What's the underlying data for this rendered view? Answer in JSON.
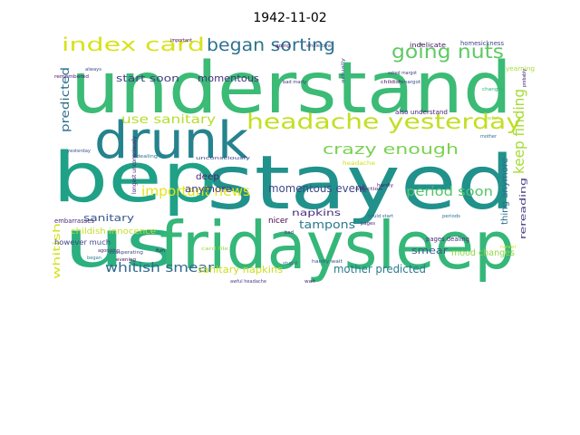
{
  "title": "1942-11-02",
  "words": [
    {
      "text": "understand",
      "color": "#3bbb75"
    },
    {
      "text": "stayed",
      "color": "#21918c"
    },
    {
      "text": "bep",
      "color": "#1fa187"
    },
    {
      "text": "us",
      "color": "#2bb07f"
    },
    {
      "text": "fridaysleep",
      "color": "#35b779"
    },
    {
      "text": "drunk",
      "color": "#25838e"
    },
    {
      "text": "headache yesterday",
      "color": "#c2df23"
    },
    {
      "text": "index card",
      "color": "#d8e219"
    },
    {
      "text": "began sorting",
      "color": "#2c728e"
    },
    {
      "text": "going nuts",
      "color": "#5ec962"
    },
    {
      "text": "crazy enough",
      "color": "#7ad151"
    },
    {
      "text": "period soon",
      "color": "#52c569"
    },
    {
      "text": "keep finding",
      "color": "#a5db36"
    },
    {
      "text": "momentous event",
      "color": "#3e4989"
    },
    {
      "text": "important news",
      "color": "#e5e419"
    },
    {
      "text": "use sanitary",
      "color": "#b5de2b"
    },
    {
      "text": "whitish smear",
      "color": "#31688e"
    },
    {
      "text": "sanitary napkins",
      "color": "#c8e020"
    },
    {
      "text": "mother predicted",
      "color": "#287c8e"
    },
    {
      "text": "napkins",
      "color": "#472d7b"
    },
    {
      "text": "tampons",
      "color": "#2a788e"
    },
    {
      "text": "smear",
      "color": "#355f8d"
    },
    {
      "text": "mood changes",
      "color": "#8fd744"
    },
    {
      "text": "start soon",
      "color": "#433e85"
    },
    {
      "text": "momentous",
      "color": "#46327e"
    },
    {
      "text": "predicted",
      "color": "#2e6e8e"
    },
    {
      "text": "sanitary",
      "color": "#38588c"
    },
    {
      "text": "anymore",
      "color": "#443983"
    },
    {
      "text": "deep",
      "color": "#481f70"
    },
    {
      "text": "whitish",
      "color": "#d2e21b"
    },
    {
      "text": "childish innocence",
      "color": "#c0df25"
    },
    {
      "text": "however much",
      "color": "#414487"
    },
    {
      "text": "thing anymore",
      "color": "#2f6c8e"
    },
    {
      "text": "rereading",
      "color": "#443b84"
    },
    {
      "text": "pages dealing",
      "color": "#472f7d"
    },
    {
      "text": "also understand",
      "color": "#482475"
    },
    {
      "text": "homesickness",
      "color": "#404688"
    },
    {
      "text": "indelicate",
      "color": "#471164"
    },
    {
      "text": "yearning",
      "color": "#a8db34"
    },
    {
      "text": "nicer",
      "color": "#440154"
    },
    {
      "text": "embarrasses",
      "color": "#482878"
    },
    {
      "text": "bad marly",
      "color": "#453581"
    },
    {
      "text": "hardly wait",
      "color": "#3b528b"
    },
    {
      "text": "asked margot",
      "color": "#424186"
    },
    {
      "text": "childish",
      "color": "#46085c"
    },
    {
      "text": "affection",
      "color": "#481a6c"
    },
    {
      "text": "headache",
      "color": "#cde11d"
    },
    {
      "text": "dealing",
      "color": "#2d708e"
    },
    {
      "text": "longest unconsciously",
      "color": "#482071"
    },
    {
      "text": "unconsciously",
      "color": "#3f4788"
    },
    {
      "text": "remembered",
      "color": "#440f76"
    },
    {
      "text": "evening",
      "color": "#471063"
    },
    {
      "text": "card file",
      "color": "#9bd93c"
    },
    {
      "text": "awful headache",
      "color": "#433d84"
    },
    {
      "text": "could start",
      "color": "#31678e"
    },
    {
      "text": "began",
      "color": "#25848e"
    },
    {
      "text": "yesterday",
      "color": "#3a548c"
    },
    {
      "text": "agonizing",
      "color": "#482677"
    },
    {
      "text": "exasperating",
      "color": "#3d4e8a"
    },
    {
      "text": "fun",
      "color": "#470e61"
    },
    {
      "text": "awful",
      "color": "#bddf26"
    },
    {
      "text": "important",
      "color": "#440154"
    },
    {
      "text": "changes",
      "color": "#29af7f"
    },
    {
      "text": "probably",
      "color": "#482374"
    },
    {
      "text": "always",
      "color": "#3e4a89"
    },
    {
      "text": "whole time",
      "color": "#404588"
    },
    {
      "text": "actually",
      "color": "#3c4f8a"
    },
    {
      "text": "going",
      "color": "#470d60"
    },
    {
      "text": "never",
      "color": "#d5e21a"
    },
    {
      "text": "mother",
      "color": "#2e6f8e"
    },
    {
      "text": "periods",
      "color": "#2b748e"
    },
    {
      "text": "pages",
      "color": "#482878"
    },
    {
      "text": "stupid",
      "color": "#31678e"
    },
    {
      "text": "wait",
      "color": "#481d6f"
    },
    {
      "text": "enough",
      "color": "#1f9a8a"
    },
    {
      "text": "hardly",
      "color": "#48186a"
    },
    {
      "text": "margot",
      "color": "#3d4d8a"
    },
    {
      "text": "bad",
      "color": "#463480"
    }
  ]
}
